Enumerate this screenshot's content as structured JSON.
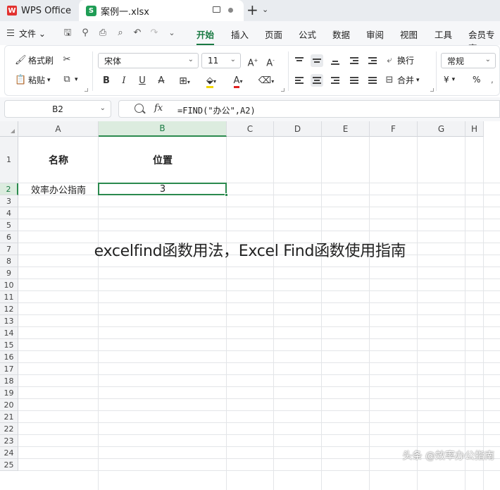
{
  "titlebar": {
    "app_tab": "WPS Office",
    "file_tab": "案例一.xlsx"
  },
  "menu": {
    "file_label": "文件",
    "tabs": [
      "开始",
      "插入",
      "页面",
      "公式",
      "数据",
      "审阅",
      "视图",
      "工具",
      "会员专享"
    ],
    "active_tab": "开始"
  },
  "ribbon": {
    "format_painter": "格式刷",
    "paste": "粘贴",
    "font_name": "宋体",
    "font_size": "11",
    "wrap_text": "换行",
    "merge": "合并",
    "number_format": "常规",
    "currency_symbol": "¥",
    "percent_symbol": "%"
  },
  "formula_bar": {
    "name_box": "B2",
    "fx_label": "fx",
    "formula": "=FIND(\"办公\",A2)"
  },
  "sheet": {
    "columns": [
      "A",
      "B",
      "C",
      "D",
      "E",
      "F",
      "G",
      "H"
    ],
    "rows": [
      "1",
      "2",
      "3",
      "4",
      "5",
      "6",
      "7",
      "8",
      "9",
      "10",
      "11",
      "12",
      "13",
      "14",
      "15",
      "16",
      "17",
      "18",
      "19",
      "20",
      "21",
      "22",
      "23",
      "24",
      "25"
    ],
    "selected_column": "B",
    "selected_row": "2",
    "cells": {
      "A1": "名称",
      "B1": "位置",
      "A2": "效率办公指南",
      "B2": "3"
    }
  },
  "overlay": {
    "title": "excelfind函数用法，Excel Find函数使用指南",
    "watermark": "头条 @效率办公指南"
  },
  "colors": {
    "accent": "#1a7a43",
    "selection": "#2b8a4e",
    "wps_red": "#e2312f",
    "sheet_green": "#1f9d55"
  }
}
